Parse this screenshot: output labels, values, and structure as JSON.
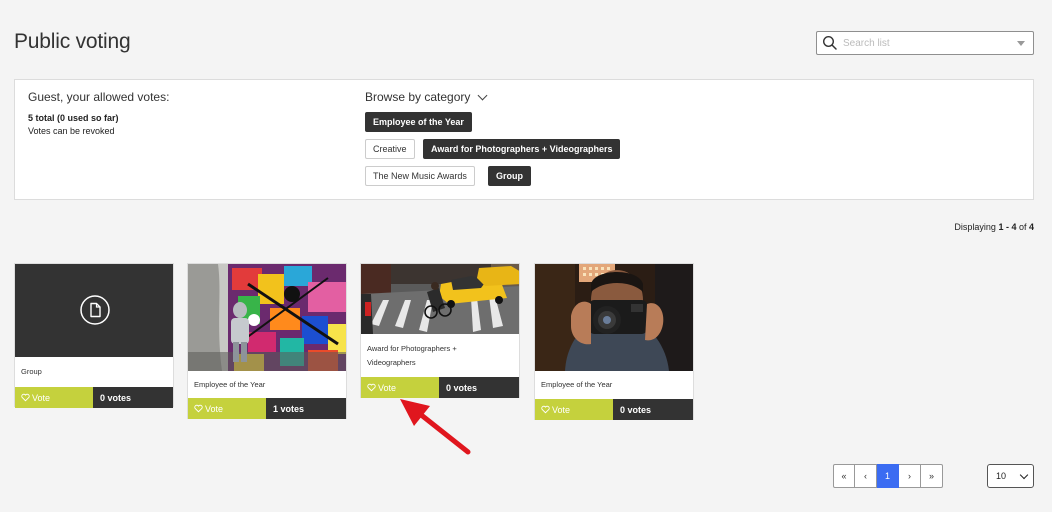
{
  "page": {
    "title": "Public voting"
  },
  "search": {
    "placeholder": "Search list",
    "value": ""
  },
  "allowance": {
    "heading": "Guest, your allowed votes:",
    "total": "5 total (0 used so far)",
    "note": "Votes can be revoked"
  },
  "categories": {
    "label": "Browse by category",
    "items": [
      {
        "label": "Employee of the Year",
        "active": true
      },
      {
        "label": "Creative",
        "active": false
      },
      {
        "label": "Award for Photographers + Videographers",
        "active": true
      },
      {
        "label": "The New Music Awards",
        "active": false
      },
      {
        "label": "Group",
        "active": true
      }
    ]
  },
  "displaying": {
    "prefix": "Displaying ",
    "range": "1 - 4",
    "of": " of ",
    "total": "4"
  },
  "entries": [
    {
      "category": "Group",
      "vote_label": "Vote",
      "votes": "0 votes",
      "thumbnail": "file-icon"
    },
    {
      "category": "Employee of the Year",
      "vote_label": "Vote",
      "votes": "1 votes",
      "thumbnail": "street-art-photo"
    },
    {
      "category": "Award for Photographers + Videographers",
      "vote_label": "Vote",
      "votes": "0 votes",
      "thumbnail": "taxi-street-photo"
    },
    {
      "category": "Employee of the Year",
      "vote_label": "Vote",
      "votes": "0 votes",
      "thumbnail": "photographer-photo"
    }
  ],
  "pagination": {
    "first": "«",
    "prev": "‹",
    "current": "1",
    "next": "›",
    "last": "»"
  },
  "per_page": {
    "value": "10"
  },
  "colors": {
    "vote": "#c5d13d",
    "dark": "#333333",
    "accent": "#3b6cf2",
    "arrow": "#e0161e"
  }
}
